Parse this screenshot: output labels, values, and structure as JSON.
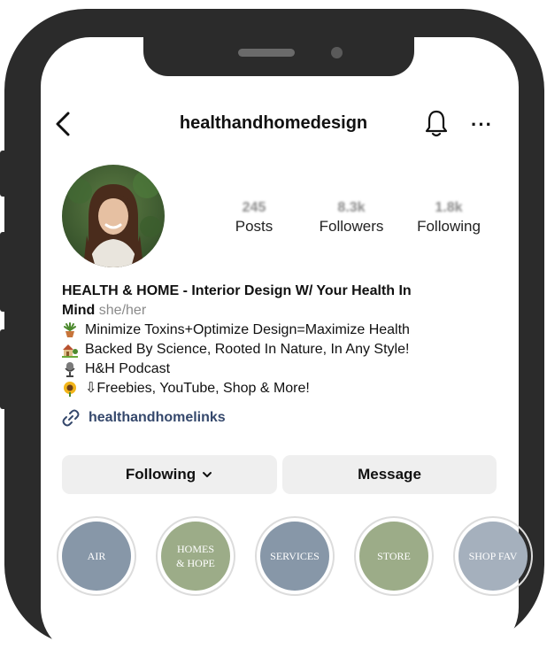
{
  "header": {
    "username": "healthandhomedesign",
    "back_icon": "chevron-left-icon",
    "bell_icon": "bell-icon",
    "more_label": "···"
  },
  "stats": [
    {
      "value": "245",
      "label": "Posts"
    },
    {
      "value": "8.3k",
      "label": "Followers"
    },
    {
      "value": "1.8k",
      "label": "Following"
    }
  ],
  "bio": {
    "name_line1": "HEALTH & HOME - Interior Design W/ Your Health In",
    "name_line2": "Mind",
    "pronouns": "she/her",
    "lines": [
      "Minimize Toxins+Optimize Design=Maximize Health",
      "Backed By Science, Rooted In Nature, In Any Style!",
      "H&H Podcast",
      "⇩Freebies, YouTube, Shop & More!"
    ]
  },
  "link": {
    "label": "healthandhomelinks"
  },
  "buttons": {
    "following_label": "Following",
    "message_label": "Message"
  },
  "highlights": [
    {
      "label": "AIR",
      "color": "#8797a8"
    },
    {
      "label": "HOMES & HOPE",
      "color": "#9cac88"
    },
    {
      "label": "SERVICES",
      "color": "#8797a8"
    },
    {
      "label": "STORE",
      "color": "#9cac88"
    },
    {
      "label": "SHOP FAV",
      "color": "#a5b0bd"
    }
  ],
  "colors": {
    "frame": "#2b2b2b",
    "link": "#35486c",
    "button_bg": "#efefef"
  }
}
